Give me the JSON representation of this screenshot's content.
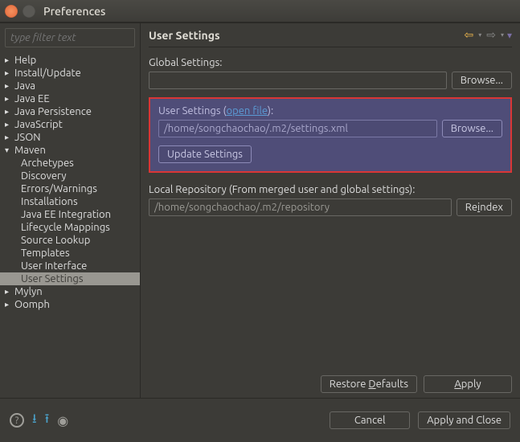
{
  "window": {
    "title": "Preferences"
  },
  "sidebar": {
    "filter_placeholder": "type filter text",
    "items": [
      {
        "label": "Help",
        "expandable": true
      },
      {
        "label": "Install/Update",
        "expandable": true
      },
      {
        "label": "Java",
        "expandable": true
      },
      {
        "label": "Java EE",
        "expandable": true
      },
      {
        "label": "Java Persistence",
        "expandable": true
      },
      {
        "label": "JavaScript",
        "expandable": true
      },
      {
        "label": "JSON",
        "expandable": true
      },
      {
        "label": "Maven",
        "expandable": true,
        "expanded": true,
        "children": [
          {
            "label": "Archetypes"
          },
          {
            "label": "Discovery"
          },
          {
            "label": "Errors/Warnings"
          },
          {
            "label": "Installations"
          },
          {
            "label": "Java EE Integration"
          },
          {
            "label": "Lifecycle Mappings"
          },
          {
            "label": "Source Lookup"
          },
          {
            "label": "Templates"
          },
          {
            "label": "User Interface"
          },
          {
            "label": "User Settings",
            "selected": true
          }
        ]
      },
      {
        "label": "Mylyn",
        "expandable": true
      },
      {
        "label": "Oomph",
        "expandable": true
      }
    ]
  },
  "content": {
    "title": "User Settings",
    "global_label": "Global Settings:",
    "global_value": "",
    "browse_label": "Browse...",
    "user_label_prefix": "User Settings (",
    "user_label_link": "open file",
    "user_label_suffix": "):",
    "user_value": "/home/songchaochao/.m2/settings.xml",
    "update_label": "Update Settings",
    "local_repo_label": "Local Repository (From merged user and global settings):",
    "local_repo_value": "/home/songchaochao/.m2/repository",
    "reindex_label": "Reindex",
    "restore_defaults": "Restore Defaults",
    "apply": "Apply"
  },
  "footer": {
    "cancel": "Cancel",
    "apply_close": "Apply and Close"
  }
}
